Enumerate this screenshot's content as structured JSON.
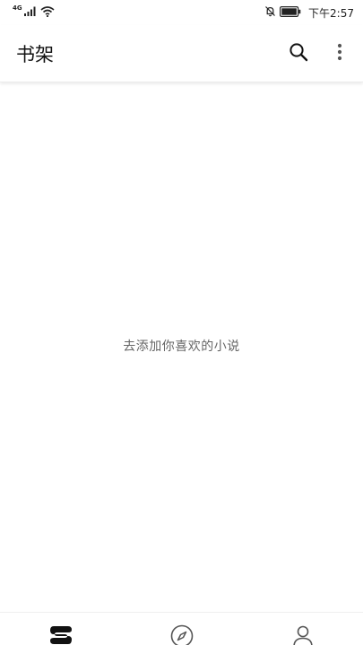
{
  "status_bar": {
    "network": "4G",
    "time": "下午2:57",
    "signal_icon": "cell-signal-icon",
    "wifi_icon": "wifi-icon",
    "mute_icon": "bell-off-icon",
    "battery_icon": "battery-icon"
  },
  "app_bar": {
    "title": "书架",
    "search_icon": "search-icon",
    "more_icon": "more-vertical-icon"
  },
  "content": {
    "empty_message": "去添加你喜欢的小说"
  },
  "bottom_nav": {
    "items": [
      {
        "icon": "bookshelf-icon",
        "active": true
      },
      {
        "icon": "compass-icon",
        "active": false
      },
      {
        "icon": "user-icon",
        "active": false
      }
    ]
  },
  "colors": {
    "active": "#111111",
    "inactive": "#555555",
    "text_muted": "#666666"
  }
}
